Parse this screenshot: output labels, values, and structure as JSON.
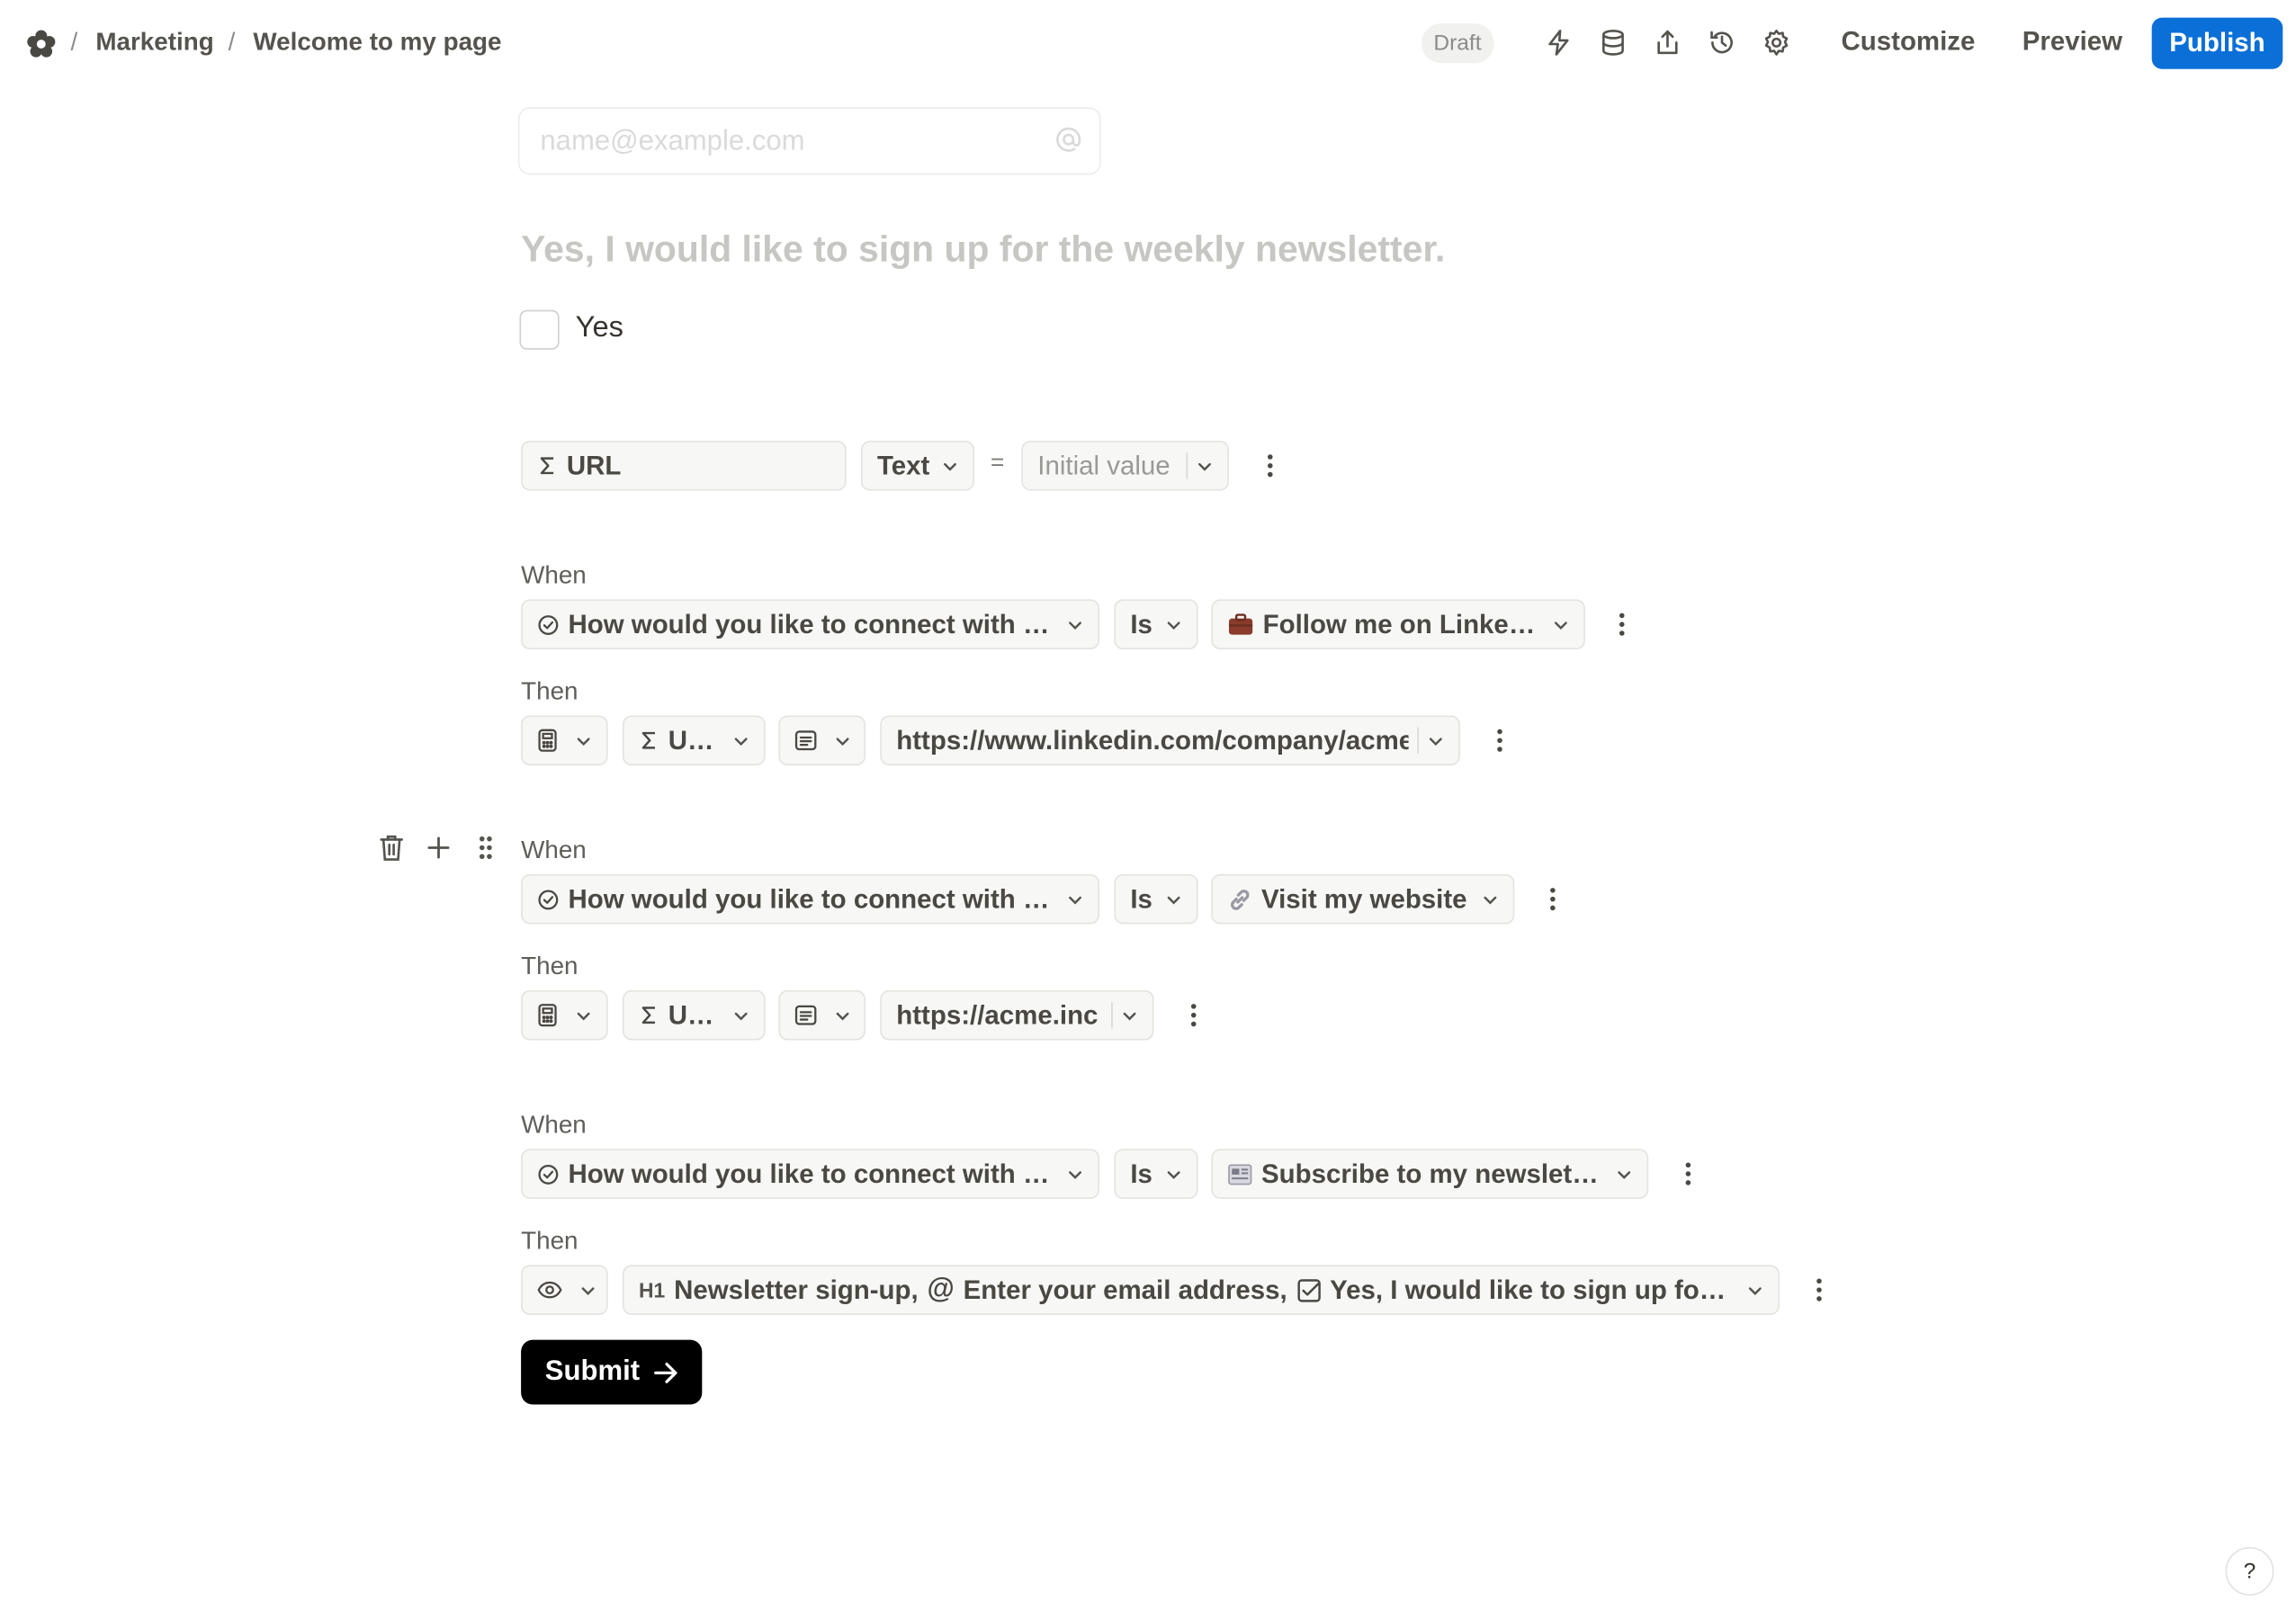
{
  "breadcrumb": {
    "items": [
      "Marketing",
      "Welcome to my page"
    ],
    "separator": "/"
  },
  "header": {
    "status_badge": "Draft",
    "icons": [
      "lightning-icon",
      "database-icon",
      "share-icon",
      "history-icon",
      "settings-icon"
    ],
    "customize_label": "Customize",
    "preview_label": "Preview",
    "publish_label": "Publish",
    "accent_color": "#0b6fd8"
  },
  "form": {
    "email_placeholder": "name@example.com",
    "question": "Yes, I would like to sign up for the weekly newsletter.",
    "checkbox_label": "Yes"
  },
  "variable": {
    "name": "URL",
    "type": "Text",
    "equals": "=",
    "value_placeholder": "Initial value"
  },
  "rules": [
    {
      "when_label": "When",
      "condition_field": "How would you like to connect with m...",
      "operator": "Is",
      "option_icon": "briefcase-icon",
      "option": "Follow me on LinkedIn",
      "then_label": "Then",
      "action_icon": "calculator-icon",
      "target": "URL",
      "value_icon": "text-value-icon",
      "value": "https://www.linkedin.com/company/acme"
    },
    {
      "when_label": "When",
      "condition_field": "How would you like to connect with m...",
      "operator": "Is",
      "option_icon": "link-icon",
      "option": "Visit my website",
      "then_label": "Then",
      "action_icon": "calculator-icon",
      "target": "URL",
      "value_icon": "text-value-icon",
      "value": "https://acme.inc"
    },
    {
      "when_label": "When",
      "condition_field": "How would you like to connect with m...",
      "operator": "Is",
      "option_icon": "newspaper-icon",
      "option": "Subscribe to my newsletter",
      "then_label": "Then",
      "action_icon": "eye-icon",
      "show_blocks": {
        "heading_marker": "H1",
        "heading": "Newsletter sign-up,",
        "email_marker": "@",
        "email": "Enter your email address,",
        "checkbox": "Yes, I would like to sign up for th..."
      }
    }
  ],
  "row_tools": [
    "trash-icon",
    "plus-icon",
    "drag-handle-icon"
  ],
  "submit_label": "Submit",
  "help_label": "?"
}
